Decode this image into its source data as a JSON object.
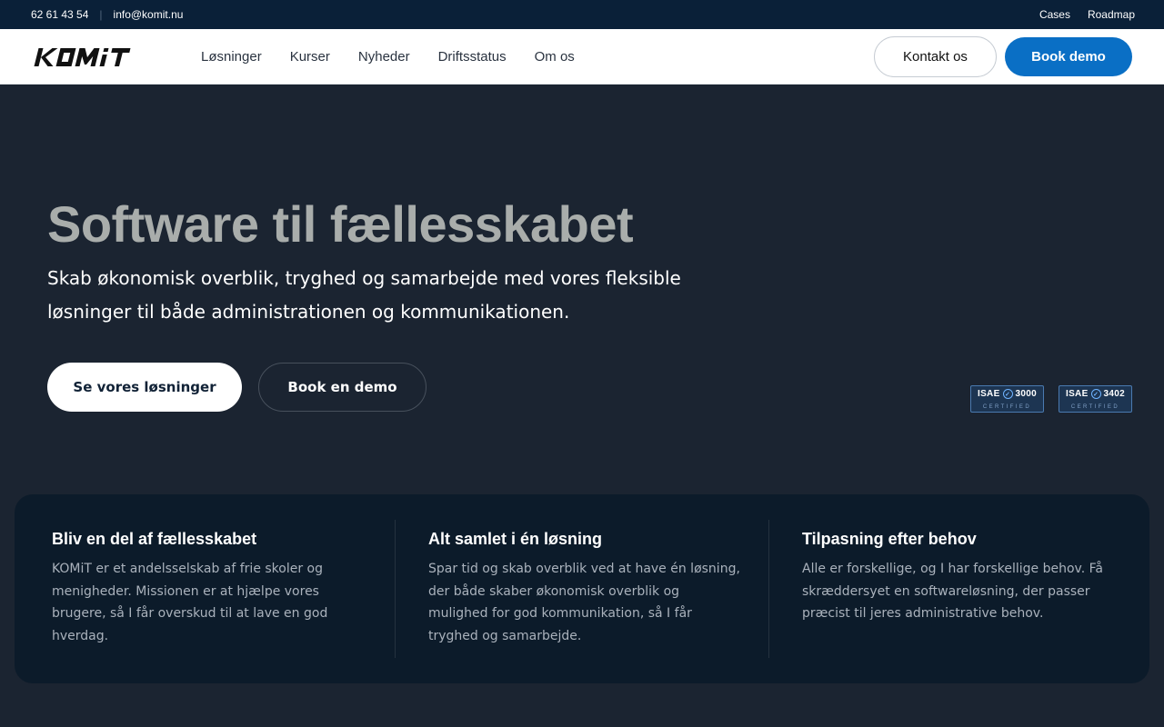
{
  "topbar": {
    "phone": "62 61 43 54",
    "separator": "|",
    "email": "info@komit.nu",
    "links": [
      "Cases",
      "Roadmap"
    ]
  },
  "nav": {
    "logo_text": "KOMiT",
    "menu": [
      "Løsninger",
      "Kurser",
      "Nyheder",
      "Driftsstatus",
      "Om os"
    ],
    "contact_label": "Kontakt os",
    "demo_label": "Book demo"
  },
  "hero": {
    "title": "Software til fællesskabet",
    "subtitle": "Skab økonomisk overblik, tryghed og samarbejde med vores fleksible løsninger til både administrationen og kommunikationen.",
    "primary_button": "Se vores løsninger",
    "secondary_button": "Book en demo"
  },
  "badges": [
    {
      "label": "ISAE",
      "number": "3000",
      "caption": "CERTIFIED"
    },
    {
      "label": "ISAE",
      "number": "3402",
      "caption": "CERTIFIED"
    }
  ],
  "features": [
    {
      "title": "Bliv en del af fællesskabet",
      "text": "KOMiT er et andelsselskab af frie skoler og menigheder. Missionen er at hjælpe vores brugere, så I får overskud til at lave en god hverdag."
    },
    {
      "title": "Alt samlet i én løsning",
      "text": "Spar tid og skab overblik ved at have én løsning, der både skaber økonomisk overblik og mulighed for god kommunikation, så I får tryghed og samarbejde."
    },
    {
      "title": "Tilpasning efter behov",
      "text": "Alle er forskellige, og I har forskellige behov. Få skræddersyet en softwareløsning, der passer præcist til jeres administrative behov."
    }
  ],
  "colors": {
    "topbar_bg": "#0a2038",
    "hero_bg": "#1b2431",
    "accent": "#0a6fc5",
    "features_bg": "#0c1b2a"
  }
}
